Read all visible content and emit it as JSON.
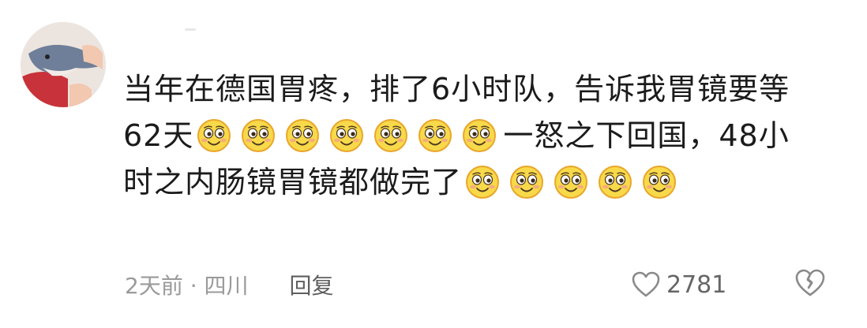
{
  "comment": {
    "segments": [
      {
        "text": "当年在德国胃疼，排了6小时队，告诉我胃镜要等62天"
      },
      {
        "emoji": "smile-icon",
        "count": 7
      },
      {
        "text": "一怒之下回国，48小时之内肠镜胃镜都做完了"
      },
      {
        "emoji": "smile-icon",
        "count": 5
      }
    ],
    "text_1": "当年在德国胃疼，排了6小时队，告诉我胃镜要等62天",
    "text_2": "一怒之下回国，48小时之内肠镜胃镜都做完了"
  },
  "meta": {
    "time_location": "2天前 · 四川",
    "reply_label": "回复"
  },
  "stats": {
    "like_count": "2781"
  },
  "colors": {
    "emoji_face": "#f8d94a",
    "emoji_outline": "#e9a62b",
    "text": "#1b1b1b",
    "meta_text": "#9a9a9a",
    "icon_gray": "#8a8a8a"
  }
}
